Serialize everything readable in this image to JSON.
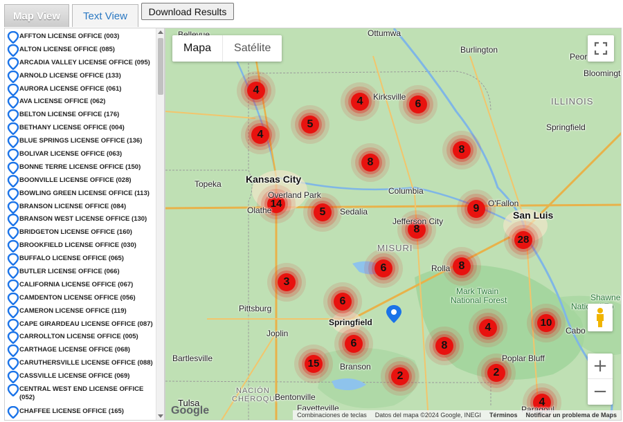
{
  "tabs": {
    "map_view": "Map View",
    "text_view": "Text View"
  },
  "toolbar": {
    "download_label": "Download Results"
  },
  "sidebar": {
    "items": [
      "AFFTON LICENSE OFFICE (003)",
      "ALTON LICENSE OFFICE (085)",
      "ARCADIA VALLEY LICENSE OFFICE (095)",
      "ARNOLD LICENSE OFFICE (133)",
      "AURORA LICENSE OFFICE (061)",
      "AVA LICENSE OFFICE (062)",
      "BELTON LICENSE OFFICE (176)",
      "BETHANY LICENSE OFFICE (004)",
      "BLUE SPRINGS LICENSE OFFICE (136)",
      "BOLIVAR LICENSE OFFICE (063)",
      "BONNE TERRE LICENSE OFFICE (150)",
      "BOONVILLE LICENSE OFFICE (028)",
      "BOWLING GREEN LICENSE OFFICE (113)",
      "BRANSON LICENSE OFFICE (084)",
      "BRANSON WEST LICENSE OFFICE (130)",
      "BRIDGETON LICENSE OFFICE (160)",
      "BROOKFIELD LICENSE OFFICE (030)",
      "BUFFALO LICENSE OFFICE (065)",
      "BUTLER LICENSE OFFICE (066)",
      "CALIFORNIA LICENSE OFFICE (067)",
      "CAMDENTON LICENSE OFFICE (056)",
      "CAMERON LICENSE OFFICE (119)",
      "CAPE GIRARDEAU LICENSE OFFICE (087)",
      "CARROLLTON LICENSE OFFICE (005)",
      "CARTHAGE LICENSE OFFICE (068)",
      "CARUTHERSVILLE LICENSE OFFICE (088)",
      "CASSVILLE LICENSE OFFICE (069)",
      "CENTRAL WEST END LICENSE OFFICE (052)",
      "CHAFFEE LICENSE OFFICE (165)"
    ]
  },
  "map": {
    "type_map": "Mapa",
    "type_satellite": "Satélite",
    "zoom_in": "+",
    "zoom_out": "−",
    "google_logo": "Google",
    "attribution": {
      "shortcuts": "Combinaciones de teclas",
      "data": "Datos del mapa ©2024 Google, INEGI",
      "terms": "Términos",
      "report": "Notificar un problema de Maps"
    },
    "places": {
      "ottumwa": "Ottumwa",
      "burlington": "Burlington",
      "peoria": "Peoria",
      "bellevue": "Bellevue",
      "bloomington": "Bloomingtor",
      "kirksville": "Kirksville",
      "illinois": "ILLINOIS",
      "springfield_il": "Springfield",
      "topeka": "Topeka",
      "kansas_city": "Kansas City",
      "overland_park": "Overland Park",
      "olathe": "Olathe",
      "columbia": "Columbia",
      "sedalia": "Sedalia",
      "ofallon": "O'Fallon",
      "san_luis": "San Luis",
      "jefferson_city": "Jefferson City",
      "misuri": "MISURI",
      "rolla": "Rolla",
      "mark_twain": "Mark Twain",
      "national_forest": "National Forest",
      "shawnee": "Shawnee",
      "national_fo": "National Fo",
      "pittsburg": "Pittsburg",
      "springfield_mo": "Springfield",
      "joplin": "Joplin",
      "cabo": "Cabo",
      "bartlesville": "Bartlesville",
      "branson": "Branson",
      "poplar_bluff": "Poplar Bluff",
      "nacion": "NACIÓN",
      "cheroqui": "CHEROQUI",
      "bentonville": "Bentonville",
      "tulsa": "Tulsa",
      "fayetteville": "Fayetteville",
      "paragould": "Paragoul"
    },
    "clusters": [
      4,
      4,
      6,
      4,
      5,
      8,
      8,
      14,
      5,
      9,
      8,
      28,
      6,
      8,
      3,
      6,
      4,
      10,
      6,
      8,
      15,
      2,
      2,
      4
    ]
  }
}
